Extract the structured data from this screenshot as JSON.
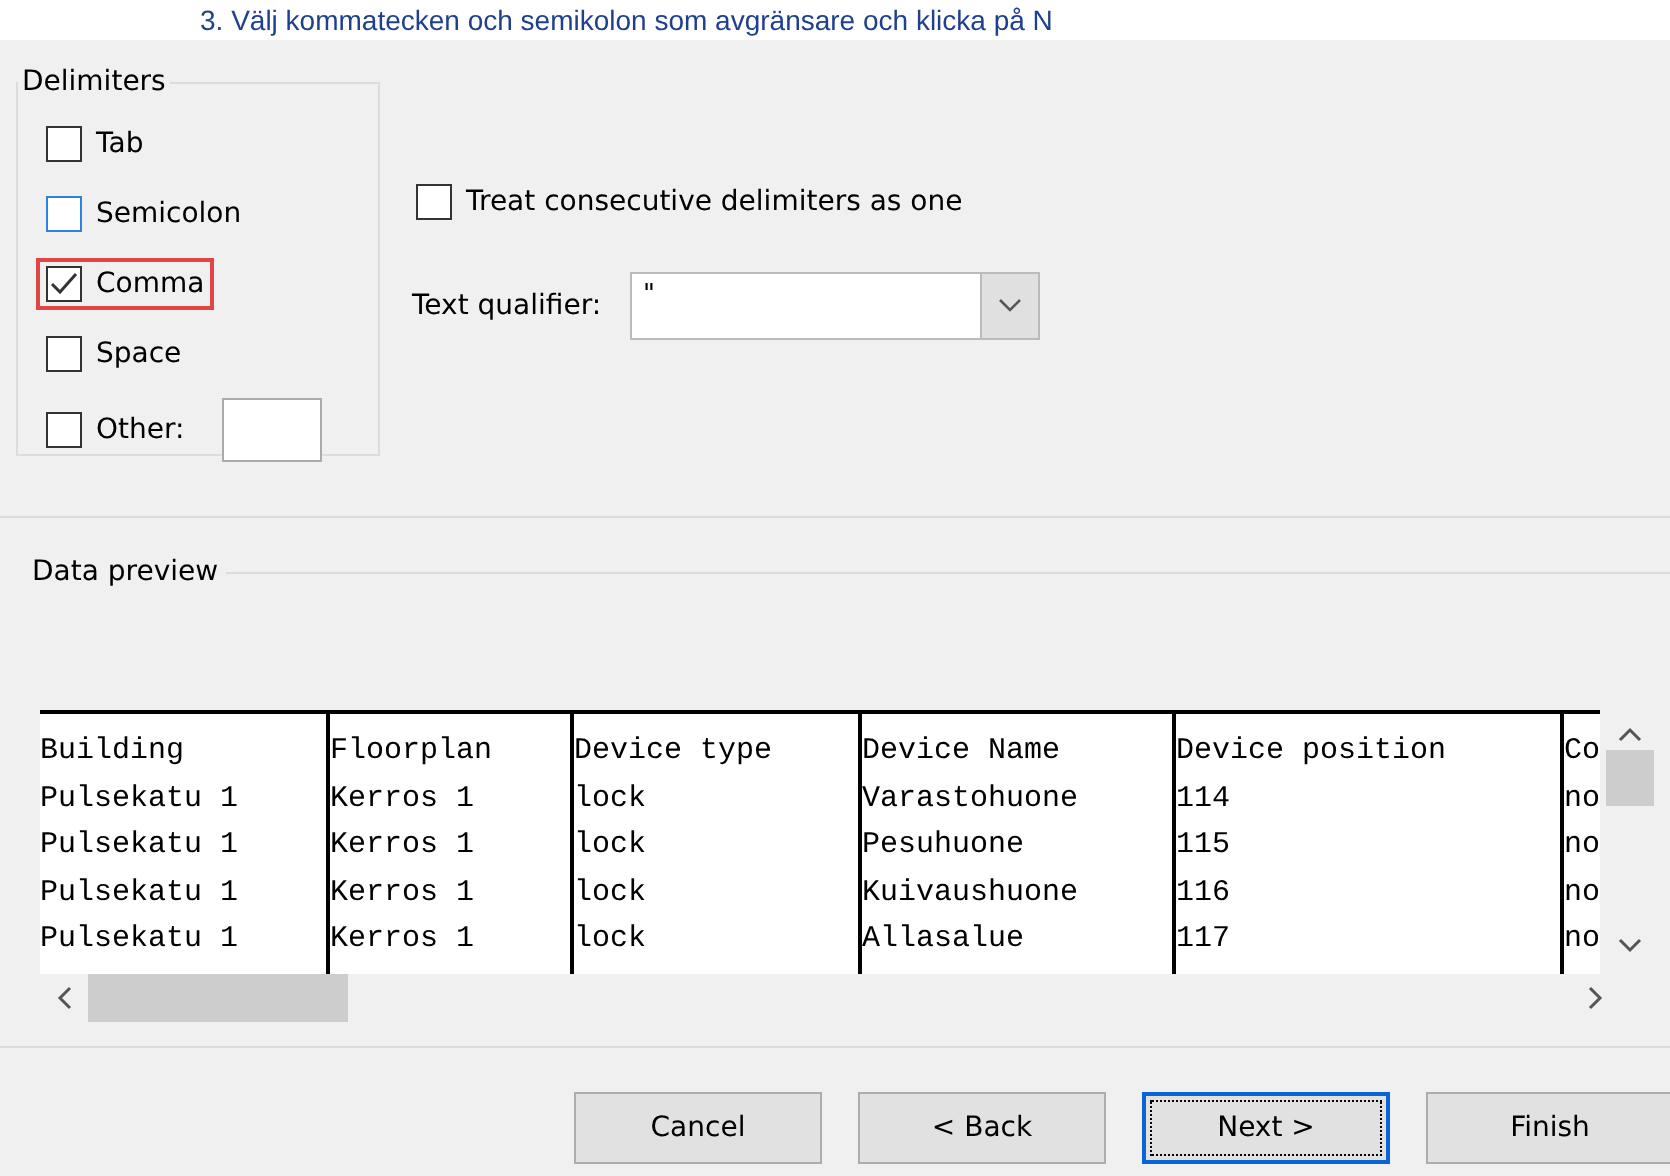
{
  "caption": "3.    Välj kommatecken och semikolon som avgränsare och klicka på N",
  "delimiters": {
    "title": "Delimiters",
    "options": [
      {
        "label": "Tab",
        "checked": false,
        "hovered": false,
        "highlighted": false
      },
      {
        "label": "Semicolon",
        "checked": false,
        "hovered": true,
        "highlighted": false
      },
      {
        "label": "Comma",
        "checked": true,
        "hovered": false,
        "highlighted": true
      },
      {
        "label": "Space",
        "checked": false,
        "hovered": false,
        "highlighted": false
      },
      {
        "label": "Other:",
        "checked": false,
        "hovered": false,
        "highlighted": false,
        "kind": "field"
      }
    ]
  },
  "consecutive": {
    "label": "Treat consecutive delimiters as one",
    "checked": false
  },
  "qualifier": {
    "label": "Text qualifier:",
    "value": "\""
  },
  "preview": {
    "title": "Data preview",
    "rows": [
      [
        "Building",
        "Floorplan",
        "Device type",
        "Device Name",
        "Device position",
        "Co"
      ],
      [
        "Pulsekatu 1",
        "Kerros 1",
        "lock",
        "Varastohuone",
        "114",
        "no"
      ],
      [
        "Pulsekatu 1",
        "Kerros 1",
        "lock",
        "Pesuhuone",
        "115",
        "no"
      ],
      [
        "Pulsekatu 1",
        "Kerros 1",
        "lock",
        "Kuivaushuone",
        "116",
        "no"
      ],
      [
        "Pulsekatu 1",
        "Kerros 1",
        "lock",
        "Allasalue",
        "117",
        "no"
      ]
    ]
  },
  "buttons": [
    {
      "label": "Cancel",
      "focused": false
    },
    {
      "label": "< Back",
      "focused": false
    },
    {
      "label": "Next >",
      "focused": true
    },
    {
      "label": "Finish",
      "focused": false
    }
  ]
}
